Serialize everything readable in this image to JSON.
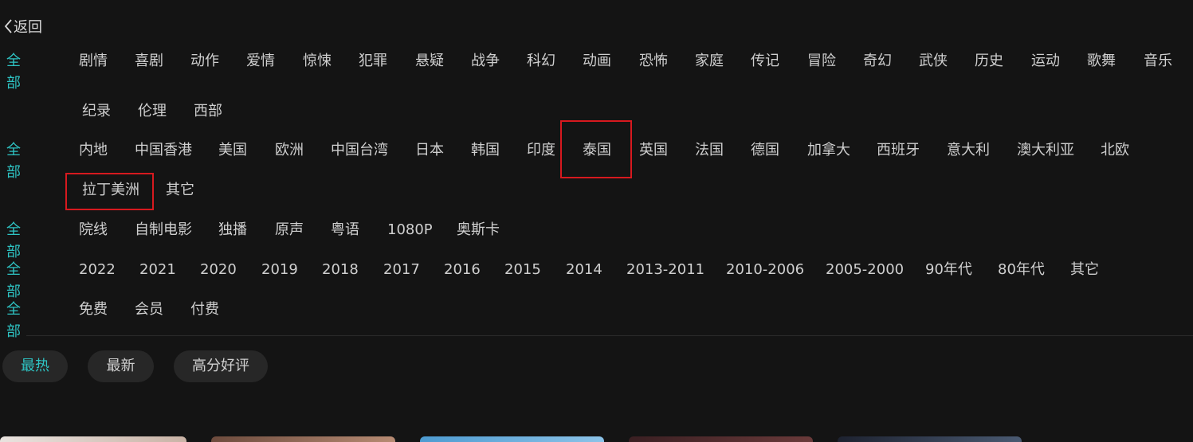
{
  "back": {
    "label": "返回",
    "icon": "chevron-left-icon"
  },
  "all_label": "全部",
  "filters": {
    "genre": [
      "剧情",
      "喜剧",
      "动作",
      "爱情",
      "惊悚",
      "犯罪",
      "悬疑",
      "战争",
      "科幻",
      "动画",
      "恐怖",
      "家庭",
      "传记",
      "冒险",
      "奇幻",
      "武侠",
      "历史",
      "运动",
      "歌舞",
      "音乐",
      "纪录",
      "伦理",
      "西部"
    ],
    "region": [
      "内地",
      "中国香港",
      "美国",
      "欧洲",
      "中国台湾",
      "日本",
      "韩国",
      "印度",
      "泰国",
      "英国",
      "法国",
      "德国",
      "加拿大",
      "西班牙",
      "意大利",
      "澳大利亚",
      "北欧",
      "拉丁美洲",
      "其它"
    ],
    "feature": [
      "院线",
      "自制电影",
      "独播",
      "原声",
      "粤语",
      "1080P",
      "奥斯卡"
    ],
    "year": [
      "2022",
      "2021",
      "2020",
      "2019",
      "2018",
      "2017",
      "2016",
      "2015",
      "2014",
      "2013-2011",
      "2010-2006",
      "2005-2000",
      "90年代",
      "80年代",
      "其它"
    ],
    "pay": [
      "免费",
      "会员",
      "付费"
    ]
  },
  "highlighted": [
    "泰国",
    "拉丁美洲"
  ],
  "sort": {
    "items": [
      "最热",
      "最新",
      "高分好评"
    ],
    "active": "最热"
  },
  "colors": {
    "background": "#141414",
    "accent": "#2ec3c3",
    "highlight_box": "#d7191f",
    "button_bg": "#272727"
  }
}
